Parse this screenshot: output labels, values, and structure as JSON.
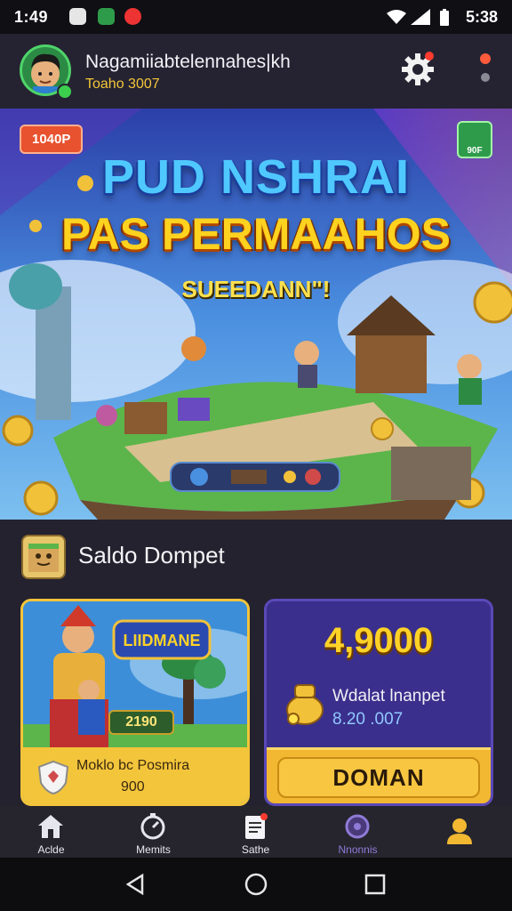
{
  "status_bar": {
    "time": "1:49",
    "clock_right": "5:38"
  },
  "header": {
    "username": "Nagamiiabtelennahes|kh",
    "subtitle": "Toaho 3007"
  },
  "banner": {
    "tag_left": "1040P",
    "tag_right": "90F",
    "title_line1": "PUD NSHRAI",
    "title_line2": "PAS PERMAAHOS",
    "subtitle": "SUEEDANN\"!"
  },
  "wallet": {
    "section_title": "Saldo Dompet",
    "promo_card": {
      "logo_text": "LIIDMANE",
      "badge_value": "2190",
      "footer_text": "Moklo bc Posmira",
      "footer_value": "900"
    },
    "balance_card": {
      "amount": "4,9000",
      "label": "Wdalat lnanpet",
      "value": "8.20 .007",
      "button_label": "DOMAN"
    }
  },
  "bottom_nav": {
    "items": [
      {
        "label": "Aclde",
        "icon": "home-icon"
      },
      {
        "label": "Memits",
        "icon": "timer-icon"
      },
      {
        "label": "Sathe",
        "icon": "notes-icon"
      },
      {
        "label": "Nnonnis",
        "icon": "circle-icon"
      },
      {
        "label": "",
        "icon": "profile-icon"
      }
    ]
  },
  "colors": {
    "accent_gold": "#f3c43a",
    "accent_purple": "#3a2f8c",
    "background": "#1f1d2b",
    "notification": "#ff3b30"
  }
}
